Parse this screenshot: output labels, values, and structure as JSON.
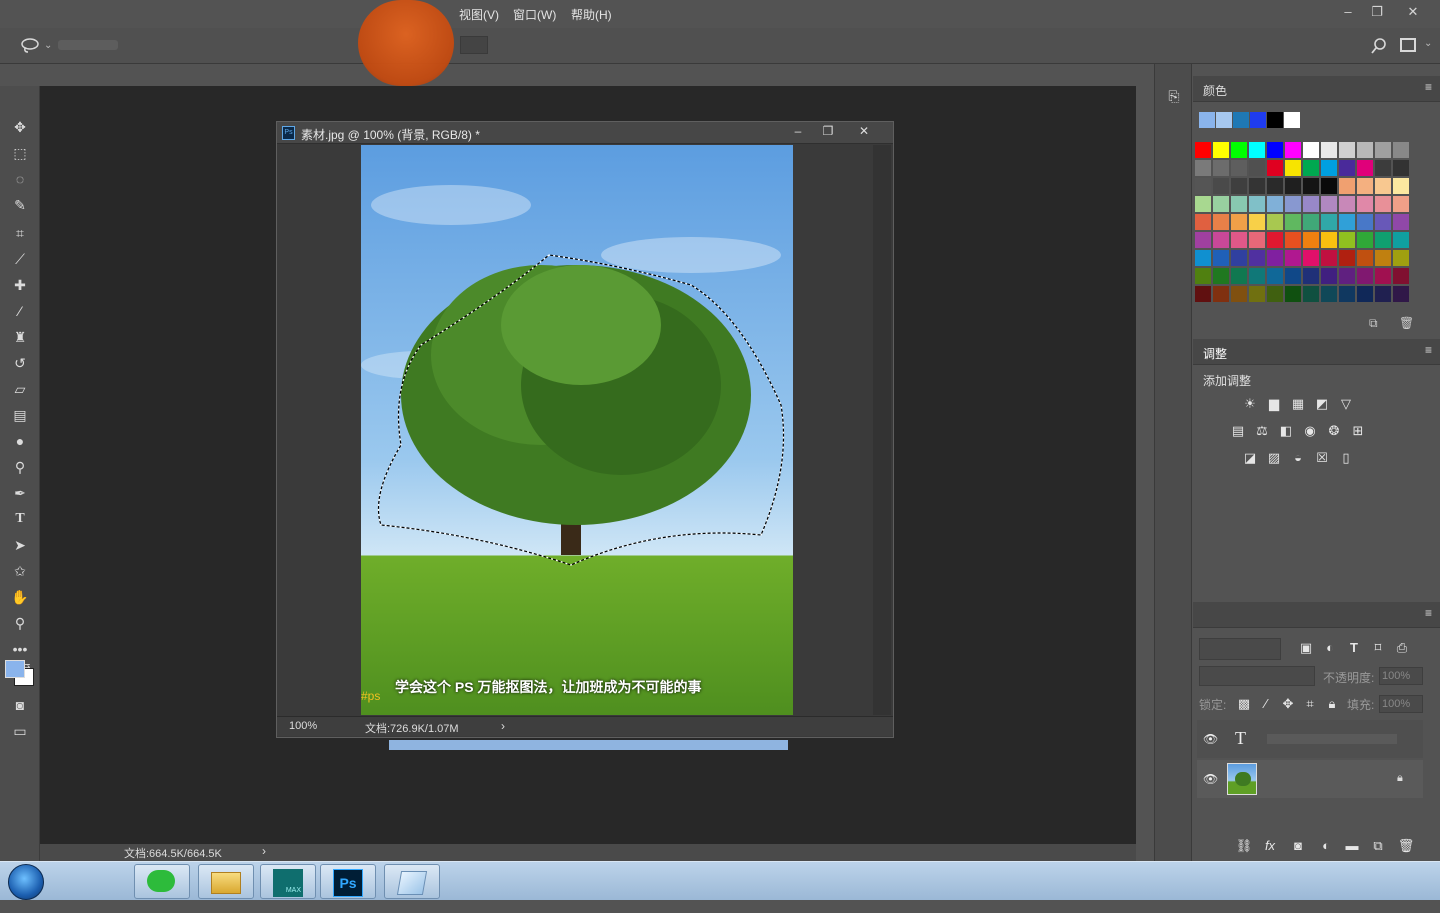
{
  "menu": {
    "view": "视图(V)",
    "window": "窗口(W)",
    "help": "帮助(H)"
  },
  "window_controls": {
    "minimize": "–",
    "restore": "❐",
    "close": "✕"
  },
  "document": {
    "title": "素材.jpg @ 100% (背景, RGB/8) *",
    "zoom": "100%",
    "doc_size": "文档:726.9K/1.07M",
    "caption": "学会这个 PS 万能抠图法，让加班成为不可能的事",
    "watermark": "#ps",
    "nav_arrow": "›"
  },
  "app_status": {
    "doc_size": "文档:664.5K/664.5K",
    "nav_arrow": "›"
  },
  "panels": {
    "color": {
      "title": "颜色"
    },
    "adjustments": {
      "title": "调整",
      "add_label": "添加调整"
    },
    "layers": {
      "opacity_label": "不透明度:",
      "opacity_value": "100%",
      "lock_label": "锁定:",
      "fill_label": "填充:",
      "fill_value": "100%"
    }
  },
  "colors": {
    "recent": [
      "#8ab4ec",
      "#a6c8f0",
      "#1f78b4",
      "#1f3cf0",
      "#000000",
      "#ffffff"
    ],
    "swatches": [
      [
        "#ff0000",
        "#ffff00",
        "#00ff00",
        "#00ffff",
        "#0000ff",
        "#ff00ff",
        "#ffffff",
        "#e8e8e8",
        "#d0d0d0",
        "#b8b8b8",
        "#a0a0a0",
        "#888888"
      ],
      [
        "#7a7a7a",
        "#6c6c6c",
        "#5e5e5e",
        "#505050",
        "#e00020",
        "#f7e400",
        "#00a850",
        "#00a0e0",
        "#4a2a9a",
        "#e0007a",
        "#3c3c3c",
        "#333333"
      ],
      [
        "#555555",
        "#4a4a4a",
        "#3f3f3f",
        "#343434",
        "#2a2a2a",
        "#1f1f1f",
        "#141414",
        "#0a0a0a",
        "#f0a070",
        "#f4b080",
        "#f8c890",
        "#fce8a0"
      ],
      [
        "#a8d890",
        "#98d0a0",
        "#88c8b0",
        "#80c0c8",
        "#80b0d8",
        "#8898d0",
        "#9888c8",
        "#b088c0",
        "#c888b8",
        "#e088a8",
        "#e89098",
        "#f0a088"
      ],
      [
        "#e06040",
        "#e88048",
        "#f0a048",
        "#f8d048",
        "#a8c850",
        "#60b860",
        "#40a878",
        "#30a8a8",
        "#30a0d8",
        "#4878c8",
        "#6858b8",
        "#9048a8"
      ],
      [
        "#a040a0",
        "#c84898",
        "#e05888",
        "#e86878",
        "#e01830",
        "#e85020",
        "#f08010",
        "#f8c010",
        "#90c020",
        "#30a838",
        "#10a070",
        "#10a0a0"
      ],
      [
        "#1090d0",
        "#2060b8",
        "#3040a0",
        "#5030a0",
        "#8020a0",
        "#b01890",
        "#e0106a",
        "#c01040",
        "#b02010",
        "#c05010",
        "#c08010",
        "#a0a010"
      ],
      [
        "#508010",
        "#207820",
        "#107850",
        "#107878",
        "#106898",
        "#104888",
        "#203078",
        "#402080",
        "#602080",
        "#801870",
        "#a01050",
        "#801030"
      ],
      [
        "#601010",
        "#803010",
        "#805010",
        "#707010",
        "#406010",
        "#105010",
        "#105040",
        "#104858",
        "#103860",
        "#102858",
        "#202050",
        "#301848"
      ]
    ]
  },
  "taskbar": {
    "apps": [
      "start-orb",
      "wechat",
      "file-explorer",
      "3ds-max",
      "photoshop",
      "notepad"
    ],
    "ps_label": "Ps",
    "max_label": "MAX"
  }
}
